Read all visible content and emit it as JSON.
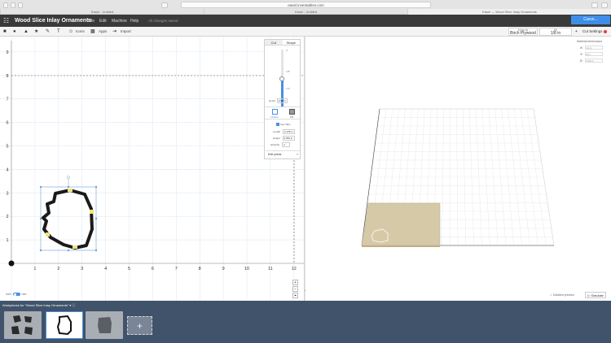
{
  "browser": {
    "url": "easel.inventables.com",
    "tabs": [
      "Easel - Untitled",
      "Easel - Untitled",
      "Easel — Wood Slice Inlay Ornaments"
    ]
  },
  "app": {
    "project_title": "Wood Slice Inlay Ornaments",
    "menu": [
      "File",
      "Edit",
      "Machine",
      "Help"
    ],
    "status": "All changes saved",
    "carve_label": "Carve..."
  },
  "toolbar": {
    "icons": [
      "square-icon",
      "circle-icon",
      "triangle-icon",
      "star-icon",
      "pen-icon",
      "text-icon"
    ],
    "icons_label": "Icons",
    "apps_label": "Apps",
    "import_label": "Import",
    "material_label": "Material",
    "material_value": "Birch Plywood",
    "bit_label": "Bit",
    "bit_value": "1/8 in",
    "cut_settings_label": "Cut Settings"
  },
  "grid": {
    "x_ticks": [
      "1",
      "2",
      "3",
      "4",
      "5",
      "6",
      "7",
      "8",
      "9",
      "10",
      "11",
      "12"
    ],
    "y_ticks": [
      "1",
      "2",
      "3",
      "4",
      "5",
      "6",
      "7",
      "8",
      "9"
    ]
  },
  "cut_panel": {
    "tabs": [
      "Cut",
      "Shape"
    ],
    "depth_ticks": [
      "0\"",
      "1/8\"",
      "1/4\""
    ],
    "depth_label": "Depth",
    "depth_value": "0.07 in",
    "depth_fraction": 0.42,
    "outline_label": "Outline",
    "fill_label": "Fill",
    "use_tabs_label": "Use Tabs",
    "length_label": "Length",
    "length_value": "0.125 in",
    "height_label": "Height",
    "height_value": "0.050 in",
    "quantity_label": "Quantity",
    "quantity_value": "4",
    "edit_points_label": "Edit points"
  },
  "right_panel": {
    "material_dims_label": "Material dimensions",
    "dims": [
      {
        "axis": "X:",
        "value": "12 in"
      },
      {
        "axis": "Y:",
        "value": "8 in"
      },
      {
        "axis": "Z:",
        "value": "0.53 in"
      }
    ],
    "detailed_preview_label": "Detailed preview",
    "simulate_label": "Simulate"
  },
  "bottom": {
    "toggle_left": "Inch",
    "toggle_right": "mm",
    "workpieces_title": "Workpieces for \"Wood Slice Inlay Ornaments\""
  },
  "colors": {
    "accent": "#3e8ee9",
    "header": "#3a3a3a",
    "workpieces_bar": "#40536a",
    "material": "#d6c9a8",
    "shape_stroke": "#1a1a1a",
    "tab_markers": "#f2e37a"
  }
}
